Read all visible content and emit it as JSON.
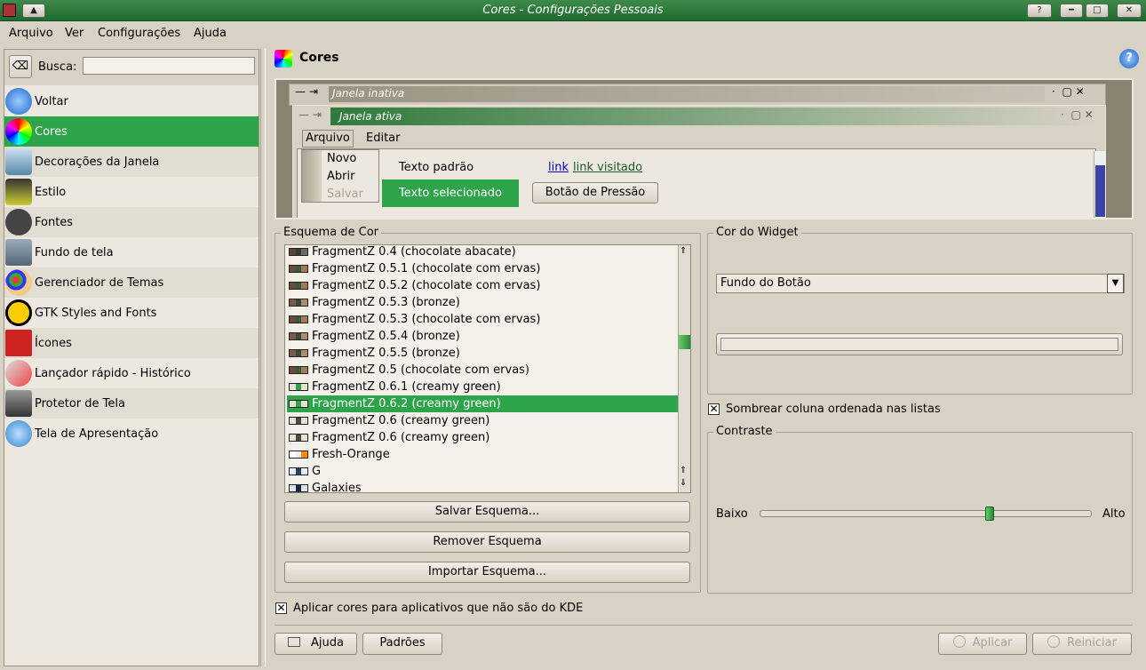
{
  "window": {
    "title": "Cores - Configurações Pessoais"
  },
  "menubar": {
    "items": [
      "Arquivo",
      "Ver",
      "Configurações",
      "Ajuda"
    ]
  },
  "sidebar": {
    "search_label": "Busca:",
    "search_value": "",
    "items": [
      {
        "label": "Voltar",
        "icon": "back-arrow-icon"
      },
      {
        "label": "Cores",
        "icon": "color-wheel-icon"
      },
      {
        "label": "Decorações da Janela",
        "icon": "window-decoration-icon"
      },
      {
        "label": "Estilo",
        "icon": "style-icon"
      },
      {
        "label": "Fontes",
        "icon": "font-icon"
      },
      {
        "label": "Fundo de tela",
        "icon": "wallpaper-icon"
      },
      {
        "label": "Gerenciador de Temas",
        "icon": "palette-icon"
      },
      {
        "label": "GTK Styles and Fonts",
        "icon": "gnome-foot-icon"
      },
      {
        "label": "Ícones",
        "icon": "icons-icon"
      },
      {
        "label": "Lançador rápido - Histórico",
        "icon": "rocket-icon"
      },
      {
        "label": "Protetor de Tela",
        "icon": "screensaver-icon"
      },
      {
        "label": "Tela de Apresentação",
        "icon": "splash-icon"
      }
    ]
  },
  "page": {
    "title": "Cores"
  },
  "preview": {
    "inactive_title": "Janela inativa",
    "active_title": "Janela ativa",
    "menu": [
      "Arquivo",
      "Editar"
    ],
    "popup": [
      "Novo",
      "Abrir",
      "Salvar"
    ],
    "normal_text": "Texto padrão",
    "selected_text": "Texto selecionado",
    "link": "link",
    "visited_link": "link visitado",
    "push_button": "Botão de Pressão"
  },
  "scheme": {
    "label": "Esquema de Cor",
    "items": [
      {
        "name": "FragmentZ 0.4 (chocolate abacate)",
        "colors": [
          "#5a4634",
          "#2f3f2a",
          "#6b6b6b"
        ]
      },
      {
        "name": "FragmentZ 0.5.1 (chocolate com ervas)",
        "colors": [
          "#6a4a36",
          "#3a5a3a",
          "#a07a5a"
        ]
      },
      {
        "name": "FragmentZ 0.5.2 (chocolate com ervas)",
        "colors": [
          "#6a4a36",
          "#3a5a3a",
          "#a07a5a"
        ]
      },
      {
        "name": "FragmentZ 0.5.3 (bronze)",
        "colors": [
          "#7a5a46",
          "#3a4a3a",
          "#b08a6a"
        ]
      },
      {
        "name": "FragmentZ 0.5.3 (chocolate com ervas)",
        "colors": [
          "#6a4a36",
          "#3a5a3a",
          "#a07a5a"
        ]
      },
      {
        "name": "FragmentZ 0.5.4 (bronze)",
        "colors": [
          "#7a5a46",
          "#3a4a3a",
          "#b08a6a"
        ]
      },
      {
        "name": "FragmentZ 0.5.5 (bronze)",
        "colors": [
          "#7a5a46",
          "#3a4a3a",
          "#b08a6a"
        ]
      },
      {
        "name": "FragmentZ 0.5 (chocolate com ervas)",
        "colors": [
          "#6a4a36",
          "#3a5a3a",
          "#a07a5a"
        ]
      },
      {
        "name": "FragmentZ 0.6.1 (creamy green)",
        "colors": [
          "#e8e2d2",
          "#2ea44a",
          "#e8e2d2"
        ]
      },
      {
        "name": "FragmentZ 0.6.2 (creamy green)",
        "colors": [
          "#e8e2d2",
          "#2ea44a",
          "#e8e2d2"
        ]
      },
      {
        "name": "FragmentZ 0.6 (creamy green)",
        "colors": [
          "#e8e2d2",
          "#4a4a3a",
          "#e8e2d2"
        ]
      },
      {
        "name": "FragmentZ 0.6 (creamy green)",
        "colors": [
          "#e8e2d2",
          "#4a4a3a",
          "#e8e2d2"
        ]
      },
      {
        "name": "Fresh-Orange",
        "colors": [
          "#ffffff",
          "#f0f0f0",
          "#ff8a00"
        ]
      },
      {
        "name": "G",
        "colors": [
          "#e8ecf4",
          "#2a3a6a",
          "#e8ecf4"
        ]
      },
      {
        "name": "Galaxies",
        "colors": [
          "#e0e4ec",
          "#1a2a4a",
          "#e0e4ec"
        ]
      }
    ],
    "selected_index": 9,
    "scroll_fraction": 0.39,
    "save_button": "Salvar Esquema...",
    "remove_button": "Remover Esquema",
    "import_button": "Importar Esquema..."
  },
  "widget_color": {
    "label": "Cor do Widget",
    "selected": "Fundo do Botão",
    "swatch_color": "#ece8df"
  },
  "shade_sorted": {
    "label": "Sombrear coluna ordenada nas listas",
    "checked": true
  },
  "contrast": {
    "label": "Contraste",
    "low": "Baixo",
    "high": "Alto",
    "value_fraction": 0.7
  },
  "apply_non_kde": {
    "label": "Aplicar cores para aplicativos que não são do KDE",
    "checked": true
  },
  "footer": {
    "help": "Ajuda",
    "defaults": "Padrões",
    "apply": "Aplicar",
    "reset": "Reiniciar"
  },
  "colors": {
    "accent": "#2ea44a",
    "titlebar": "#2f7a3c",
    "background": "#d8d2c5"
  }
}
